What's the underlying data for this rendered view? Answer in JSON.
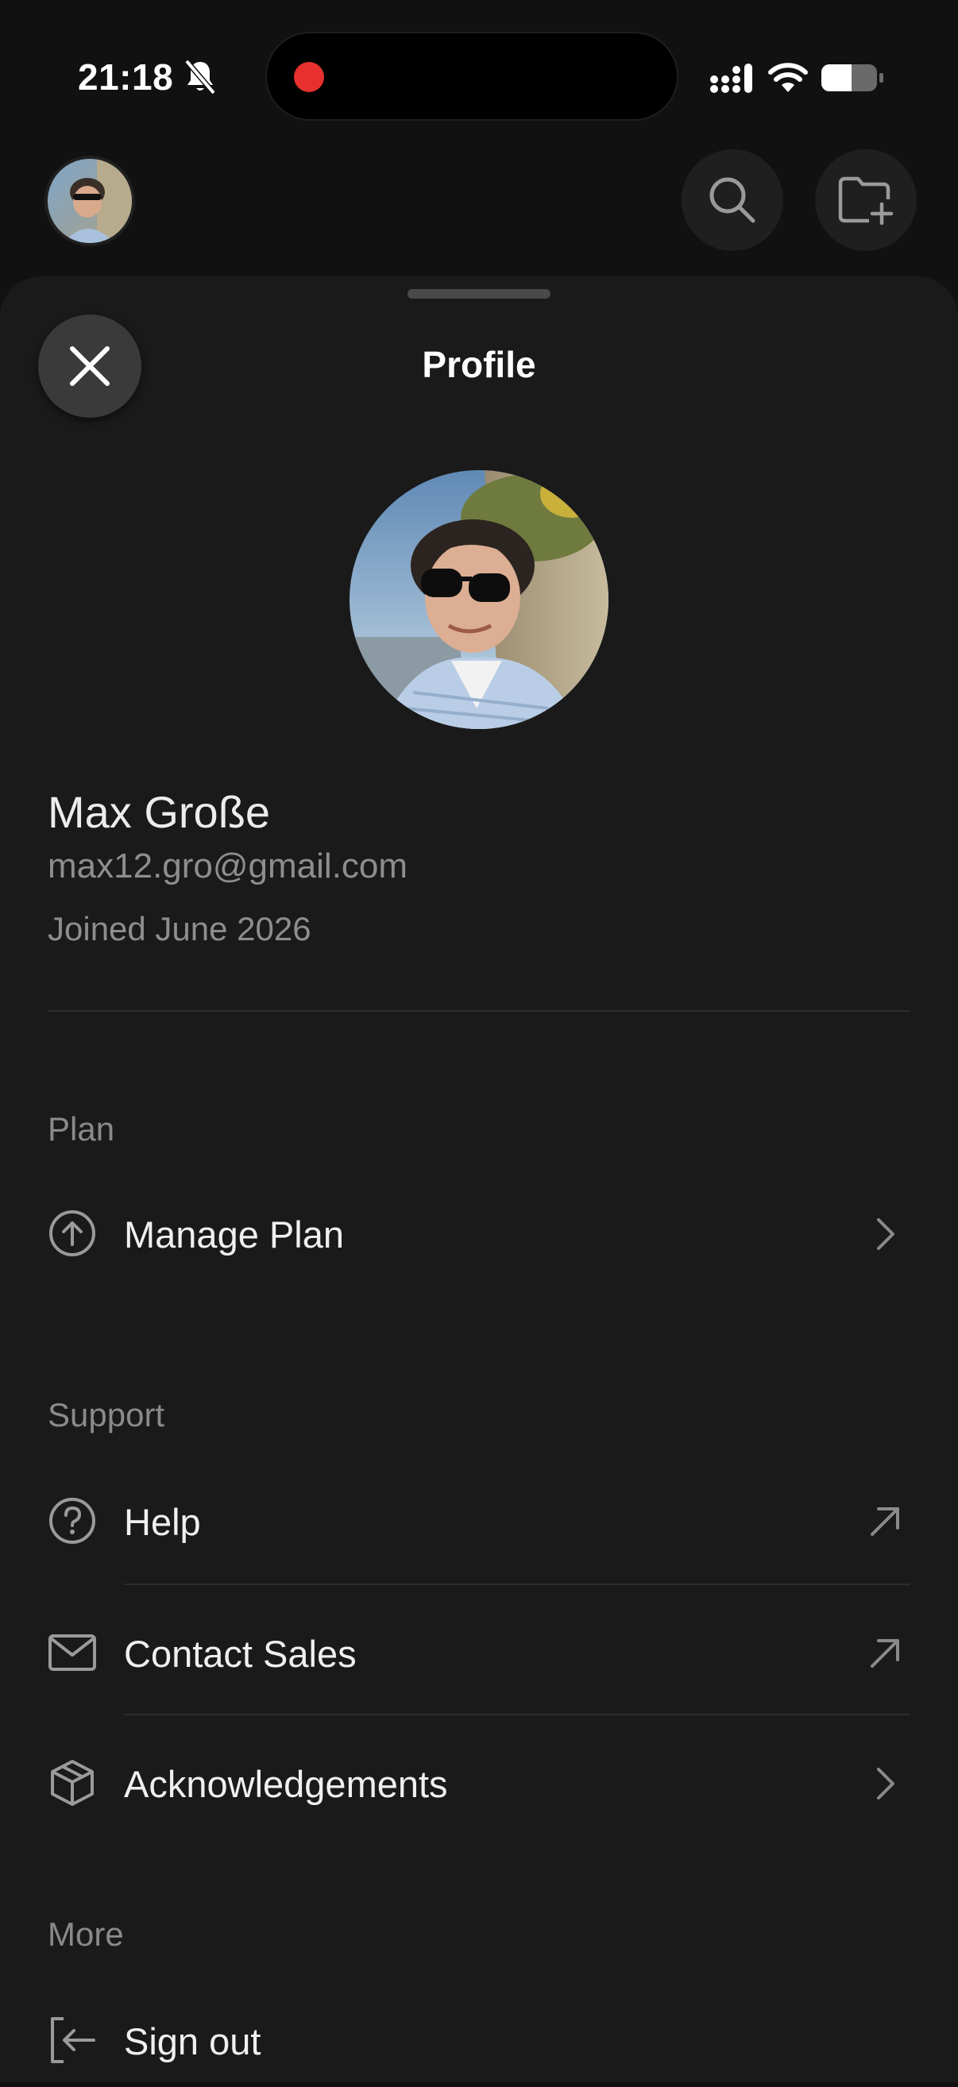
{
  "status_bar": {
    "time": "21:18",
    "icons": [
      "bell-slash-icon",
      "signal-icon",
      "wifi-icon",
      "battery-icon"
    ],
    "recording_color": "#e8312f"
  },
  "header": {
    "icons": [
      "search-icon",
      "folder-plus-icon"
    ]
  },
  "sheet": {
    "title": "Profile",
    "close_icon": "close-icon"
  },
  "profile": {
    "name": "Max Große",
    "email": "max12.gro@gmail.com",
    "joined": "Joined June 2026"
  },
  "sections": {
    "plan": {
      "label": "Plan",
      "items": [
        {
          "label": "Manage Plan",
          "icon": "arrow-up-circle-icon",
          "trailing": "chevron-right-icon"
        }
      ]
    },
    "support": {
      "label": "Support",
      "items": [
        {
          "label": "Help",
          "icon": "question-circle-icon",
          "trailing": "external-arrow-icon"
        },
        {
          "label": "Contact Sales",
          "icon": "mail-icon",
          "trailing": "external-arrow-icon"
        },
        {
          "label": "Acknowledgements",
          "icon": "package-icon",
          "trailing": "chevron-right-icon"
        }
      ]
    },
    "more": {
      "label": "More",
      "items": [
        {
          "label": "Sign out",
          "icon": "sign-out-icon"
        }
      ]
    }
  },
  "colors": {
    "background": "#111111",
    "sheet": "#1a1a1a",
    "text_primary": "#f0f0f0",
    "text_secondary": "#8e8e8e"
  }
}
